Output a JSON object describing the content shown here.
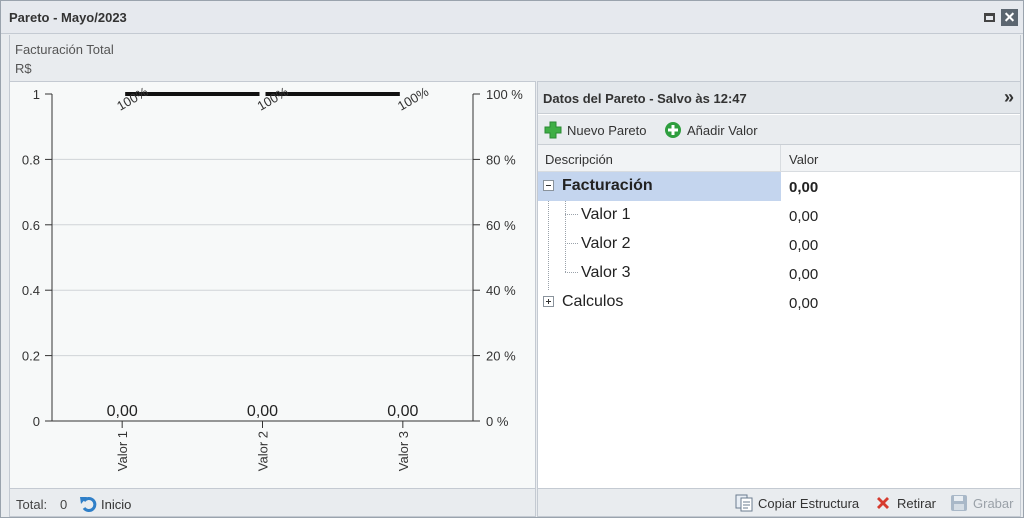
{
  "window": {
    "title": "Pareto - Mayo/2023"
  },
  "header": {
    "line1": "Facturación Total",
    "line2": "R$"
  },
  "chart_data": {
    "type": "bar",
    "categories": [
      "Valor 1",
      "Valor 2",
      "Valor 3"
    ],
    "values": [
      0,
      0,
      0
    ],
    "value_labels": [
      "0,00",
      "0,00",
      "0,00"
    ],
    "cumulative_percent": [
      100,
      100,
      100
    ],
    "cumulative_labels": [
      "100%",
      "100%",
      "100%"
    ],
    "ylim": [
      0,
      1
    ],
    "y_ticks": [
      "0",
      "0.2",
      "0.4",
      "0.6",
      "0.8",
      "1"
    ],
    "y2lim": [
      0,
      100
    ],
    "y2_ticks": [
      "0 %",
      "20 %",
      "40 %",
      "60 %",
      "80 %",
      "100 %"
    ],
    "grid": true
  },
  "chart_footer": {
    "total_label": "Total:",
    "total_value": "0",
    "inicio_label": "Inicio"
  },
  "data_panel": {
    "title": "Datos del Pareto - Salvo às 12:47",
    "toolbar": {
      "new_label": "Nuevo Pareto",
      "add_label": "Añadir Valor"
    },
    "columns": [
      "Descripción",
      "Valor"
    ],
    "rows": [
      {
        "label": "Facturación",
        "value": "0,00"
      },
      {
        "label": "Valor 1",
        "value": "0,00"
      },
      {
        "label": "Valor 2",
        "value": "0,00"
      },
      {
        "label": "Valor 3",
        "value": "0,00"
      },
      {
        "label": "Calculos",
        "value": "0,00"
      }
    ]
  },
  "data_footer": {
    "copy_label": "Copiar Estructura",
    "retirar_label": "Retirar",
    "grabar_label": "Grabar"
  },
  "colors": {
    "selection": "#c4d5ee",
    "add_icon_green": "#2e9e3e",
    "delete_icon_red": "#d63b2f",
    "cumulative_line": "#111111"
  },
  "icons": [
    "maximize-icon",
    "close-icon",
    "collapse-arrows-icon",
    "add-cross-icon",
    "add-circle-icon",
    "undo-icon",
    "copy-document-icon",
    "delete-x-icon",
    "save-disk-icon"
  ]
}
